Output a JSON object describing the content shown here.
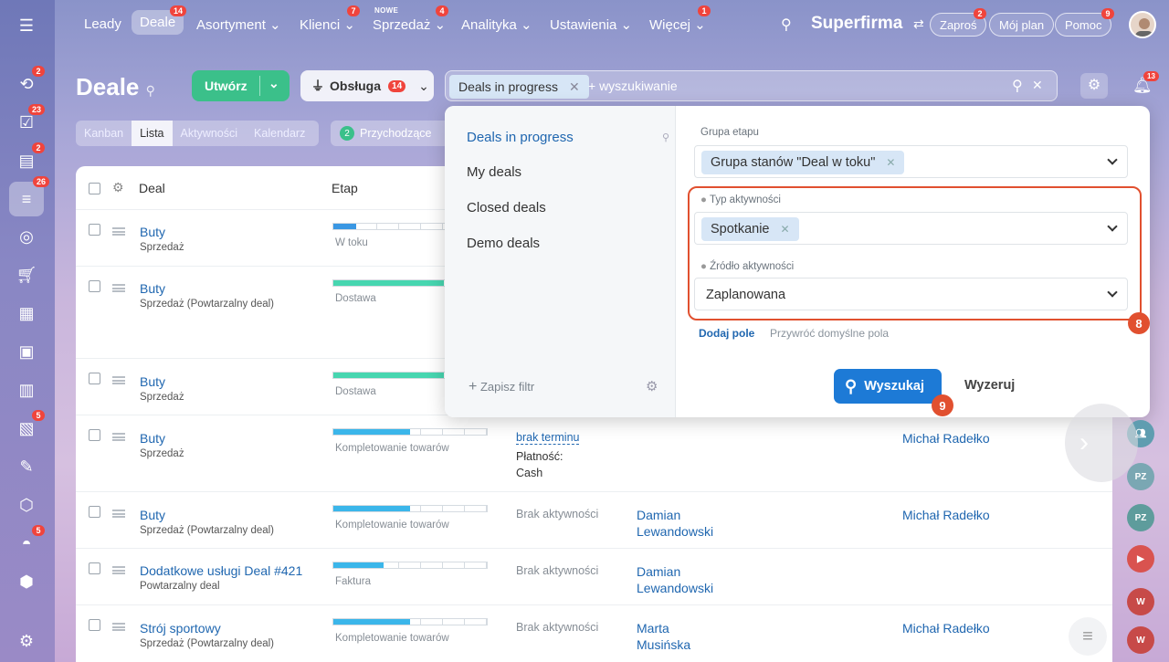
{
  "nav": {
    "items": [
      {
        "label": "Leady"
      },
      {
        "label": "Deale",
        "badge": "14"
      },
      {
        "label": "Asortyment ⌄"
      },
      {
        "label": "Klienci ⌄",
        "badge": "7"
      },
      {
        "label": "Sprzedaż ⌄",
        "badge": "4",
        "tag": "NOWE"
      },
      {
        "label": "Analityka ⌄"
      },
      {
        "label": "Ustawienia ⌄"
      },
      {
        "label": "Więcej ⌄",
        "badge": "1"
      }
    ],
    "brand": "Superfirma",
    "invite": "Zaproś",
    "invite_badge": "2",
    "plan": "Mój plan",
    "help": "Pomoc",
    "help_badge": "9"
  },
  "leftbar": {
    "badges": [
      "2",
      "23",
      "2",
      "26",
      "5",
      "5"
    ]
  },
  "page": {
    "title": "Deale",
    "create": "Utwórz",
    "service": "Obsługa",
    "service_badge": "14",
    "search_chip": "Deals in progress",
    "search_placeholder": "+ wyszukiwanie",
    "bell_badge": "13"
  },
  "views": [
    "Kanban",
    "Lista",
    "Aktywności",
    "Kalendarz"
  ],
  "counter": {
    "count": "2",
    "label": "Przychodzące"
  },
  "table": {
    "headers": [
      "Deal",
      "Etap"
    ],
    "rows": [
      {
        "title": "Buty",
        "sub": "Sprzedaż",
        "stage": "W toku",
        "color": "#3a97e3",
        "fill": 0.15
      },
      {
        "title": "Buty",
        "sub": "Sprzedaż (Powtarzalny deal)",
        "stage": "Dostawa",
        "color": "#47d6b0",
        "fill": 0.72
      },
      {
        "title": "Buty",
        "sub": "Sprzedaż",
        "stage": "Dostawa",
        "color": "#47d6b0",
        "fill": 0.72
      },
      {
        "title": "Buty",
        "sub": "Sprzedaż",
        "stage": "Kompletowanie towarów",
        "color": "#3bb6ea",
        "fill": 0.5,
        "activity": "brak terminu",
        "pay_label": "Płatność:",
        "pay_value": "Cash",
        "resp": "Michał Radełko"
      },
      {
        "title": "Buty",
        "sub": "Sprzedaż (Powtarzalny deal)",
        "stage": "Kompletowanie towarów",
        "color": "#3bb6ea",
        "fill": 0.5,
        "activity": "Brak aktywności",
        "client1": "Damian",
        "client2": "Lewandowski",
        "resp": "Michał Radełko"
      },
      {
        "title": "Dodatkowe usługi Deal #421",
        "sub": "Powtarzalny deal",
        "stage": "Faktura",
        "color": "#3bb6ea",
        "fill": 0.33,
        "activity": "Brak aktywności",
        "client1": "Damian",
        "client2": "Lewandowski"
      },
      {
        "title": "Strój sportowy",
        "sub": "Sprzedaż (Powtarzalny deal)",
        "stage": "Kompletowanie towarów",
        "color": "#3bb6ea",
        "fill": 0.5,
        "activity": "Brak aktywności",
        "client1": "Marta",
        "client2": "Musińska",
        "resp": "Michał Radełko"
      }
    ]
  },
  "filter": {
    "presets": [
      "Deals in progress",
      "My deals",
      "Closed deals",
      "Demo deals"
    ],
    "save": "Zapisz filtr",
    "group_label": "Grupa etapu",
    "group_value": "Grupa stanów \"Deal w toku\"",
    "type_label": "Typ aktywności",
    "type_value": "Spotkanie",
    "source_label": "Źródło aktywności",
    "source_value": "Zaplanowana",
    "add_field": "Dodaj pole",
    "restore": "Przywróć domyślne pola",
    "search_btn": "Wyszukaj",
    "reset_btn": "Wyzeruj"
  },
  "markers": {
    "m8": "8",
    "m9": "9"
  },
  "rightbar": [
    "PZ",
    "PZ",
    "W",
    "W"
  ]
}
